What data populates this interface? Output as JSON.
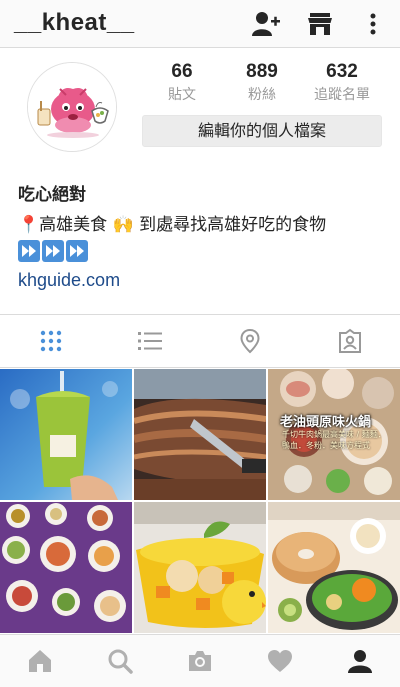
{
  "header": {
    "username": "__kheat__",
    "icons": [
      "add-user-icon",
      "shop-icon",
      "more-vertical-icon"
    ]
  },
  "profile": {
    "stats": [
      {
        "value": "66",
        "label": "貼文"
      },
      {
        "value": "889",
        "label": "粉絲"
      },
      {
        "value": "632",
        "label": "追蹤名單"
      }
    ],
    "edit_button_label": "編輯你的個人檔案",
    "name": "吃心絕對",
    "bio_line": "📍高雄美食 🙌 到處尋找高雄好吃的食物",
    "bio_arrows": [
      "fast-forward-icon",
      "fast-forward-icon",
      "fast-forward-icon"
    ],
    "website": "khguide.com"
  },
  "tabs": [
    "grid-view-icon",
    "list-view-icon",
    "location-pin-icon",
    "tagged-photos-icon"
  ],
  "grid": {
    "posts": [
      {
        "overlay_title": "",
        "overlay_text": ""
      },
      {
        "overlay_title": "",
        "overlay_text": ""
      },
      {
        "overlay_title": "老油頭原味火鍋",
        "overlay_text": "千切牛肉鍋最高美味 / 麵麵．鴨血．冬粉．美味方程式"
      },
      {
        "overlay_title": "",
        "overlay_text": ""
      },
      {
        "overlay_title": "",
        "overlay_text": ""
      },
      {
        "overlay_title": "",
        "overlay_text": ""
      }
    ]
  },
  "bottom_nav": [
    "home-icon",
    "search-icon",
    "camera-icon",
    "heart-icon",
    "profile-icon"
  ],
  "colors": {
    "accent": "#1e4b8a",
    "icon_gray": "#999999",
    "tab_active": "#4a90d9"
  }
}
